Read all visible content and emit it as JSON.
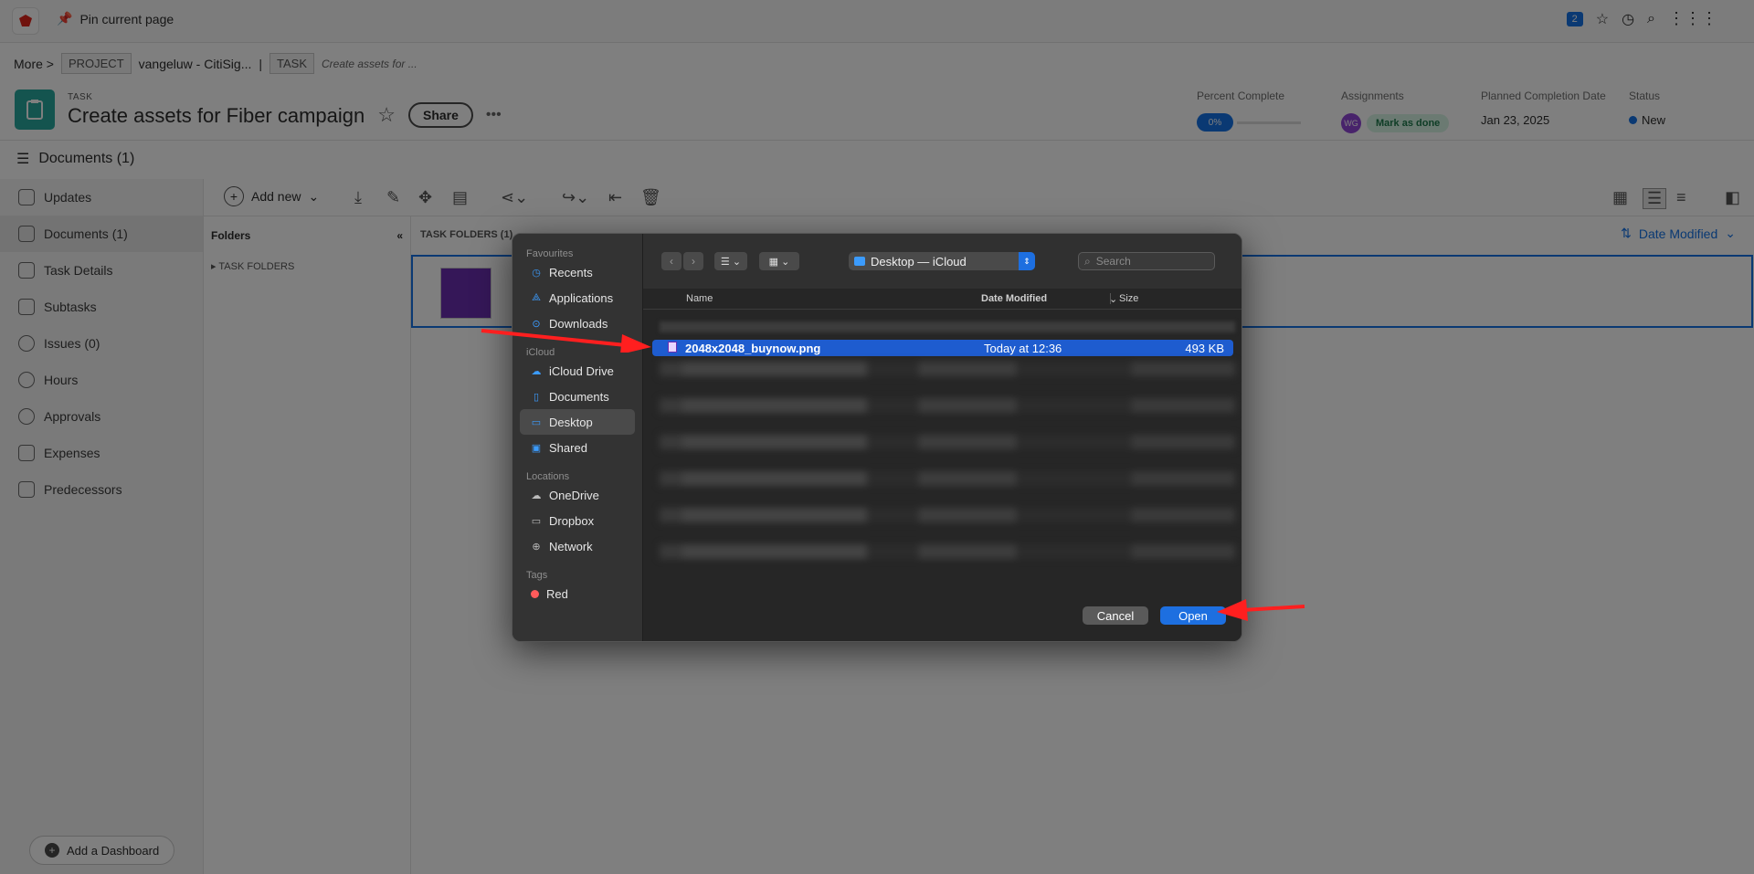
{
  "topbar": {
    "pin_label": "Pin current page",
    "notif_count": "2"
  },
  "breadcrumb": {
    "more": "More >",
    "project_chip": "PROJECT",
    "project_name": "vangeluw - CitiSig...",
    "task_chip": "TASK",
    "task_name": "Create assets for ..."
  },
  "task": {
    "type_label": "TASK",
    "title": "Create assets for Fiber campaign",
    "share_label": "Share",
    "more_label": "•••"
  },
  "meta": {
    "percent_label": "Percent Complete",
    "percent_value": "0%",
    "assign_label": "Assignments",
    "assignee_initials": "WG",
    "mark_done": "Mark as done",
    "planned_label": "Planned Completion Date",
    "planned_value": "Jan 23, 2025",
    "status_label": "Status",
    "status_value": "New"
  },
  "docs_title": "Documents (1)",
  "leftnav": [
    {
      "label": "Updates"
    },
    {
      "label": "Documents (1)"
    },
    {
      "label": "Task Details"
    },
    {
      "label": "Subtasks"
    },
    {
      "label": "Issues (0)"
    },
    {
      "label": "Hours"
    },
    {
      "label": "Approvals"
    },
    {
      "label": "Expenses"
    },
    {
      "label": "Predecessors"
    }
  ],
  "dashboard_btn": "Add a Dashboard",
  "toolbar": {
    "add_new": "Add new"
  },
  "folders": {
    "header": "Folders",
    "task_folders": "TASK FOLDERS"
  },
  "main": {
    "header": "TASK FOLDERS (1)",
    "sort_label": "Date Modified"
  },
  "dialog": {
    "sidebar": {
      "favourites_label": "Favourites",
      "favourites": [
        {
          "label": "Recents"
        },
        {
          "label": "Applications"
        },
        {
          "label": "Downloads"
        }
      ],
      "icloud_label": "iCloud",
      "icloud": [
        {
          "label": "iCloud Drive"
        },
        {
          "label": "Documents"
        },
        {
          "label": "Desktop"
        },
        {
          "label": "Shared"
        }
      ],
      "locations_label": "Locations",
      "locations": [
        {
          "label": "OneDrive"
        },
        {
          "label": "Dropbox"
        },
        {
          "label": "Network"
        }
      ],
      "tags_label": "Tags",
      "tags": [
        {
          "label": "Red"
        }
      ]
    },
    "location": "Desktop — iCloud",
    "search_placeholder": "Search",
    "columns": {
      "name": "Name",
      "date": "Date Modified",
      "size": "Size"
    },
    "selected_file": {
      "name": "2048x2048_buynow.png",
      "date": "Today at 12:36",
      "size": "493 KB"
    },
    "cancel": "Cancel",
    "open": "Open"
  },
  "colors": {
    "accent": "#1473e6",
    "selection": "#1e5ccf",
    "annotation": "#ff1f1f"
  }
}
